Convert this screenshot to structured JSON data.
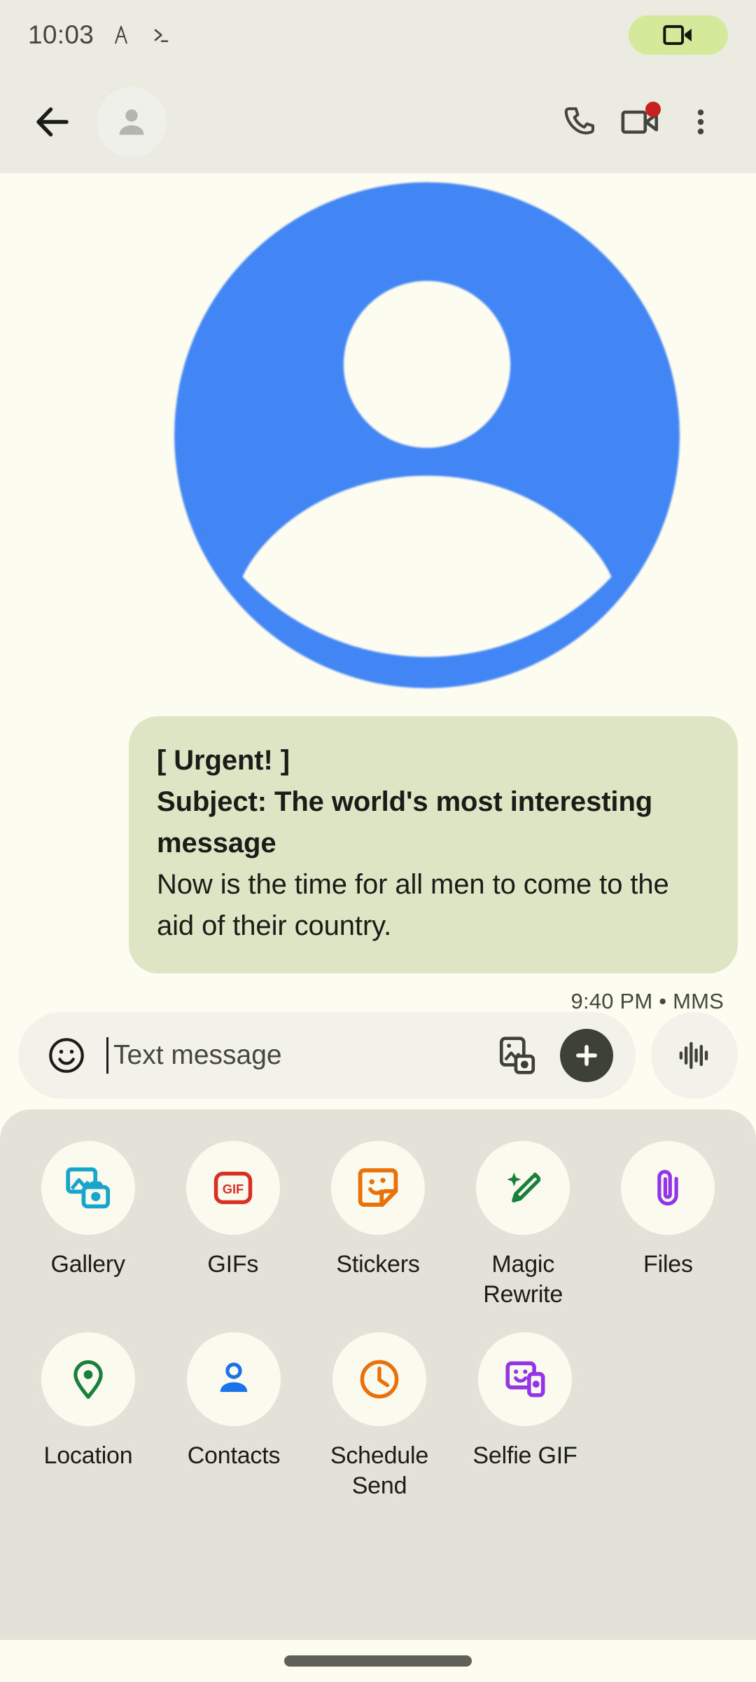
{
  "status_bar": {
    "time": "10:03",
    "icons": [
      {
        "name": "font-size-indicator-icon",
        "glyph": "A"
      },
      {
        "name": "terminal-icon",
        "glyph": ">_"
      }
    ],
    "chip": {
      "name": "screen-recording-chip",
      "icon": "videocam-icon",
      "color": "#D4EA9A"
    },
    "background": "#EBEBE2"
  },
  "app_bar": {
    "back_label": "Back",
    "avatar": {
      "name": "contact-avatar",
      "type": "person-icon"
    },
    "actions": [
      {
        "name": "call-button",
        "icon": "phone-icon",
        "label": "Call"
      },
      {
        "name": "video-call-button",
        "icon": "videocam-icon",
        "label": "Video call",
        "badge": true,
        "badge_color": "#C5221F"
      },
      {
        "name": "more-options-button",
        "icon": "overflow-menu-icon",
        "label": "More options"
      }
    ],
    "background": "#EBEBE2"
  },
  "conversation": {
    "background": "#FDFCF0",
    "hero_avatar": {
      "name": "large-contact-avatar",
      "icon": "person-icon",
      "color": "#4285F4"
    },
    "message": {
      "bubble_color": "#DDE5C5",
      "lines": [
        {
          "text": "[ Urgent! ]",
          "bold": true
        },
        {
          "text": "Subject: The world's most interesting message",
          "bold": true
        },
        {
          "text": "Now is the time for all men to come to the aid of their country.",
          "bold": false
        }
      ],
      "timestamp": "9:40 PM • MMS"
    }
  },
  "compose": {
    "emoji_icon": "emoji-smiley-icon",
    "placeholder": "Text message",
    "value": "",
    "gallery_icon": "photo-camera-icon",
    "plus_label": "Add attachment",
    "mic_label": "Voice message",
    "field_background": "#F2F2EA",
    "plus_background": "#3E4138"
  },
  "attachments": {
    "background": "#E2E2D9",
    "circle_background": "#FBFAEF",
    "row1": [
      {
        "label": "Gallery",
        "icon": "gallery-icon",
        "color": "#19A5CB"
      },
      {
        "label": "GIFs",
        "icon": "gif-icon",
        "color": "#D93025"
      },
      {
        "label": "Stickers",
        "icon": "sticker-icon",
        "color": "#E8710A"
      },
      {
        "label": "Magic Rewrite",
        "icon": "magic-pencil-icon",
        "color": "#188038"
      },
      {
        "label": "Files",
        "icon": "paperclip-icon",
        "color": "#9334E6"
      }
    ],
    "row2": [
      {
        "label": "Location",
        "icon": "location-pin-icon",
        "color": "#188038"
      },
      {
        "label": "Contacts",
        "icon": "contact-person-icon",
        "color": "#1A73E8"
      },
      {
        "label": "Schedule Send",
        "icon": "clock-icon",
        "color": "#E8710A"
      },
      {
        "label": "Selfie GIF",
        "icon": "selfie-gif-icon",
        "color": "#9334E6"
      }
    ]
  },
  "nav_bar": {
    "gesture_handle": "home-gesture-pill",
    "background": "#FDFCF0"
  }
}
